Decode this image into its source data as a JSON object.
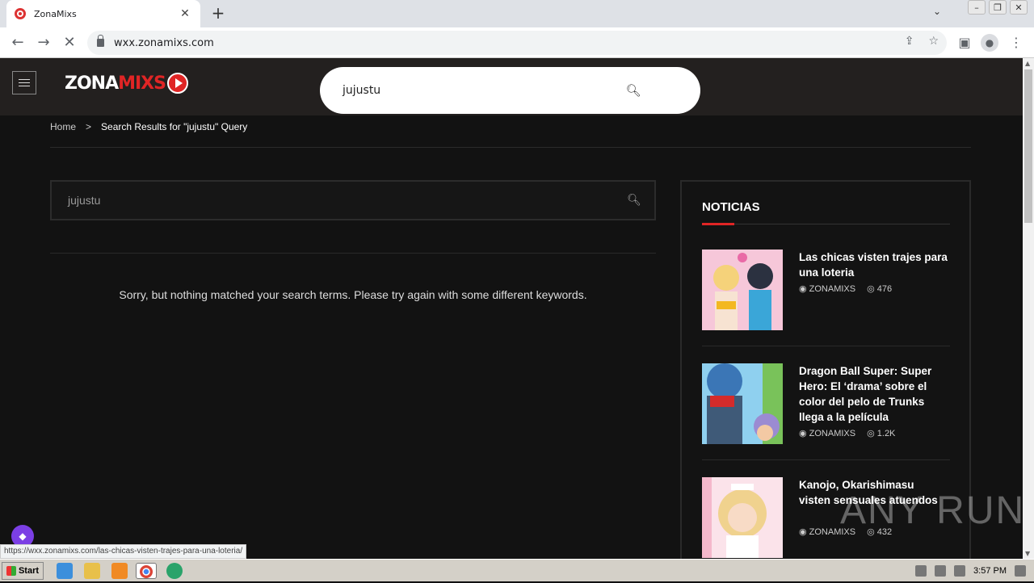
{
  "browser": {
    "tab_title": "ZonaMixs",
    "url": "wxx.zonamixs.com",
    "status_url": "https://wxx.zonamixs.com/las-chicas-visten-trajes-para-una-loteria/"
  },
  "site": {
    "logo_part1": "ZONA",
    "logo_part2": "MIXS",
    "header_search_value": "jujustu"
  },
  "breadcrumb": {
    "home": "Home",
    "separator": ">",
    "current": "Search Results for \"jujustu\" Query"
  },
  "search": {
    "value": "jujustu",
    "no_results": "Sorry, but nothing matched your search terms. Please try again with some different keywords."
  },
  "sidebar": {
    "title": "NOTICIAS",
    "posts": [
      {
        "title": "Las chicas visten trajes para una loteria",
        "author": "ZONAMIXS",
        "views": "476"
      },
      {
        "title": "Dragon Ball Super: Super Hero: El ‘drama’ sobre el color del pelo de Trunks llega a la película",
        "author": "ZONAMIXS",
        "views": "1.2K"
      },
      {
        "title": "Kanojo, Okarishimasu visten sensuales atuendos",
        "author": "ZONAMIXS",
        "views": "432"
      }
    ]
  },
  "watermark": "ANY RUN",
  "taskbar": {
    "start": "Start",
    "clock": "3:57 PM"
  },
  "colors": {
    "accent": "#e02525",
    "header_bg": "#23201f",
    "page_bg": "#121212"
  }
}
